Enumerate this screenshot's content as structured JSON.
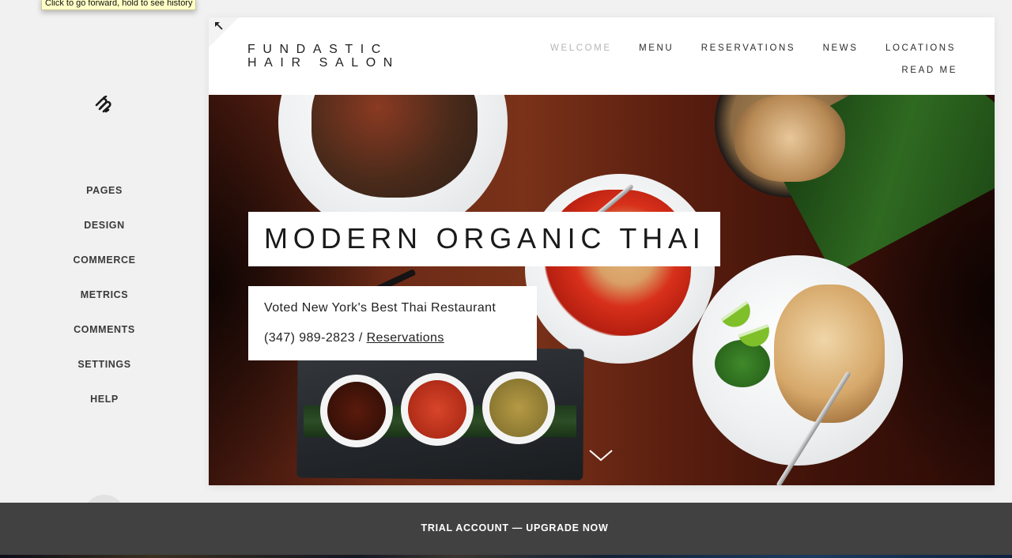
{
  "tooltip": "Click to go forward, hold to see history",
  "sidebar": {
    "logo_icon": "squarespace-logo-icon",
    "items": [
      {
        "label": "PAGES"
      },
      {
        "label": "DESIGN"
      },
      {
        "label": "COMMERCE"
      },
      {
        "label": "METRICS"
      },
      {
        "label": "COMMENTS"
      },
      {
        "label": "SETTINGS"
      },
      {
        "label": "HELP"
      }
    ]
  },
  "site": {
    "brand": {
      "line1": "FUNDASTIC",
      "line2": "HAIR SALON"
    },
    "nav": [
      {
        "label": "WELCOME",
        "active": true
      },
      {
        "label": "MENU"
      },
      {
        "label": "RESERVATIONS"
      },
      {
        "label": "NEWS"
      },
      {
        "label": "LOCATIONS"
      },
      {
        "label": "READ ME"
      }
    ],
    "corner_icon": "expand-arrow-icon",
    "hero": {
      "headline": "MODERN ORGANIC THAI",
      "tagline": "Voted New York's Best Thai Restaurant",
      "phone": "(347) 989-2823 /",
      "reservations_link": "Reservations",
      "scroll_icon": "chevron-down-icon"
    }
  },
  "trial_bar": {
    "label": "TRIAL ACCOUNT — UPGRADE NOW"
  },
  "colors": {
    "sidebar_bg": "#f1f1f1",
    "nav_active": "#b5b5b5",
    "trial_bar_bg": "#414141"
  }
}
